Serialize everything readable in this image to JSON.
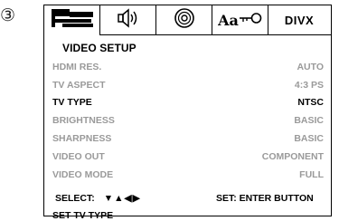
{
  "step_number": "③",
  "tabs": [
    {
      "icon": "video-setup-icon",
      "active": true
    },
    {
      "icon": "speaker-icon",
      "active": false
    },
    {
      "icon": "disc-icon",
      "active": false
    },
    {
      "icon": "language-lock-icon",
      "active": false,
      "text": "Aa"
    },
    {
      "icon": "divx-icon",
      "active": false,
      "text": "DIVX"
    }
  ],
  "menu": {
    "title": "VIDEO SETUP",
    "items": [
      {
        "label": "HDMI RES.",
        "value": "AUTO"
      },
      {
        "label": "TV ASPECT",
        "value": "4:3 PS"
      },
      {
        "label": "TV TYPE",
        "value": "NTSC",
        "selected": true
      },
      {
        "label": "BRIGHTNESS",
        "value": "BASIC"
      },
      {
        "label": "SHARPNESS",
        "value": "BASIC"
      },
      {
        "label": "VIDEO OUT",
        "value": "COMPONENT"
      },
      {
        "label": "VIDEO MODE",
        "value": "FULL"
      }
    ]
  },
  "footer": {
    "select_label": "SELECT:",
    "select_arrows": "▼▲◀▶",
    "set_label": "SET: ENTER BUTTON"
  },
  "hint": "SET TV TYPE",
  "colors": {
    "selected": "#000000",
    "unselected": "#9a9a9a"
  }
}
